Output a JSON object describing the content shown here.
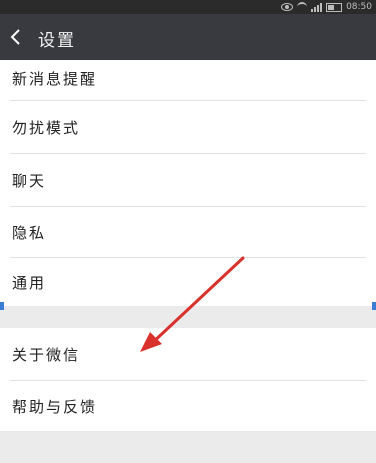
{
  "status_bar": {
    "time": "08:50"
  },
  "header": {
    "title": "设置",
    "back_icon": "chevron-left-icon"
  },
  "settings": {
    "group1": [
      {
        "label": "新消息提醒"
      },
      {
        "label": "勿扰模式"
      },
      {
        "label": "聊天"
      },
      {
        "label": "隐私"
      },
      {
        "label": "通用"
      }
    ],
    "group2": [
      {
        "label": "关于微信"
      },
      {
        "label": "帮助与反馈"
      }
    ]
  },
  "annotation": {
    "color": "#d9312b",
    "points_to": "关于微信"
  },
  "colors": {
    "titlebar": "#393a3f",
    "background": "#ffffff",
    "separator": "#ebebeb"
  }
}
